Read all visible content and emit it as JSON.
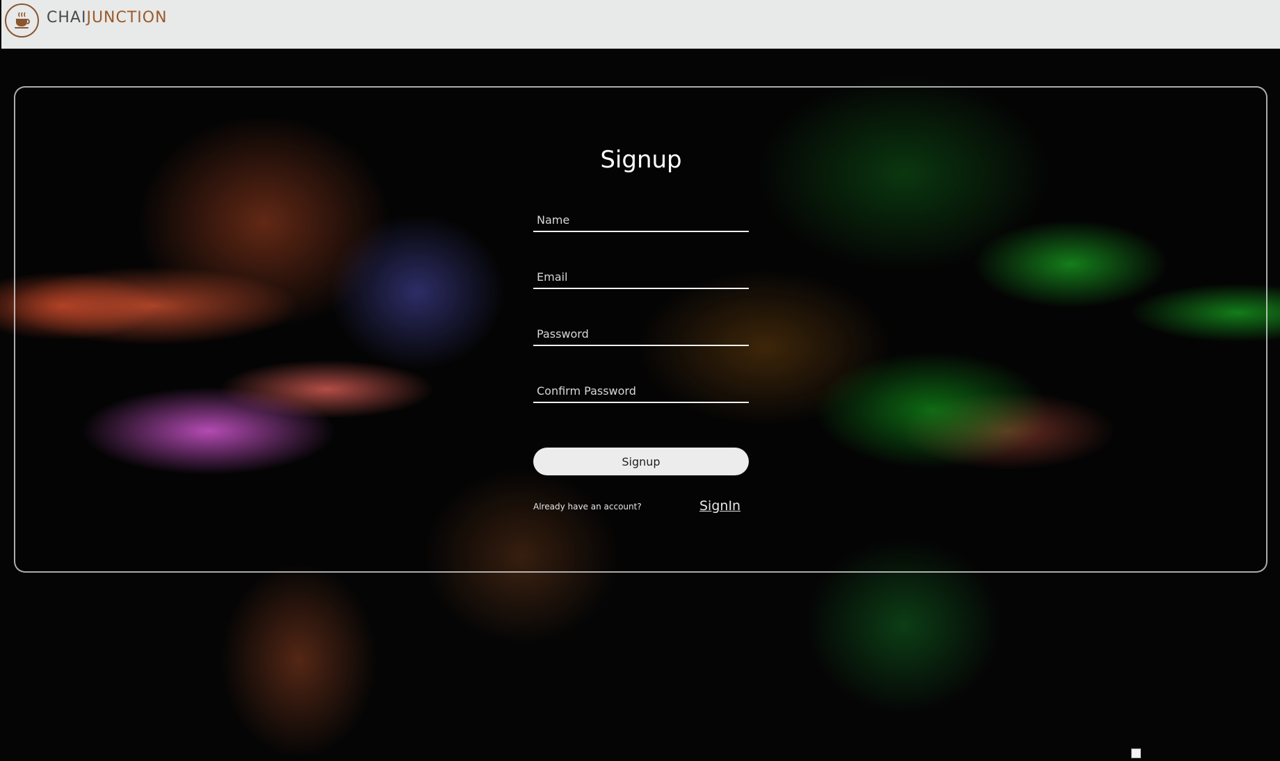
{
  "header": {
    "logo_icon": "coffee-cup-icon",
    "brand_primary": "CHAI",
    "brand_accent": "JUNCTION",
    "brand_color": "#9a5a2a"
  },
  "form": {
    "title": "Signup",
    "fields": {
      "name_placeholder": "Name",
      "email_placeholder": "Email",
      "password_placeholder": "Password",
      "confirm_password_placeholder": "Confirm Password"
    },
    "submit_label": "Signup",
    "already_text": "Already have an account?",
    "signin_label": "SignIn"
  },
  "footer": {
    "badge_icon": "broken-image-icon"
  }
}
